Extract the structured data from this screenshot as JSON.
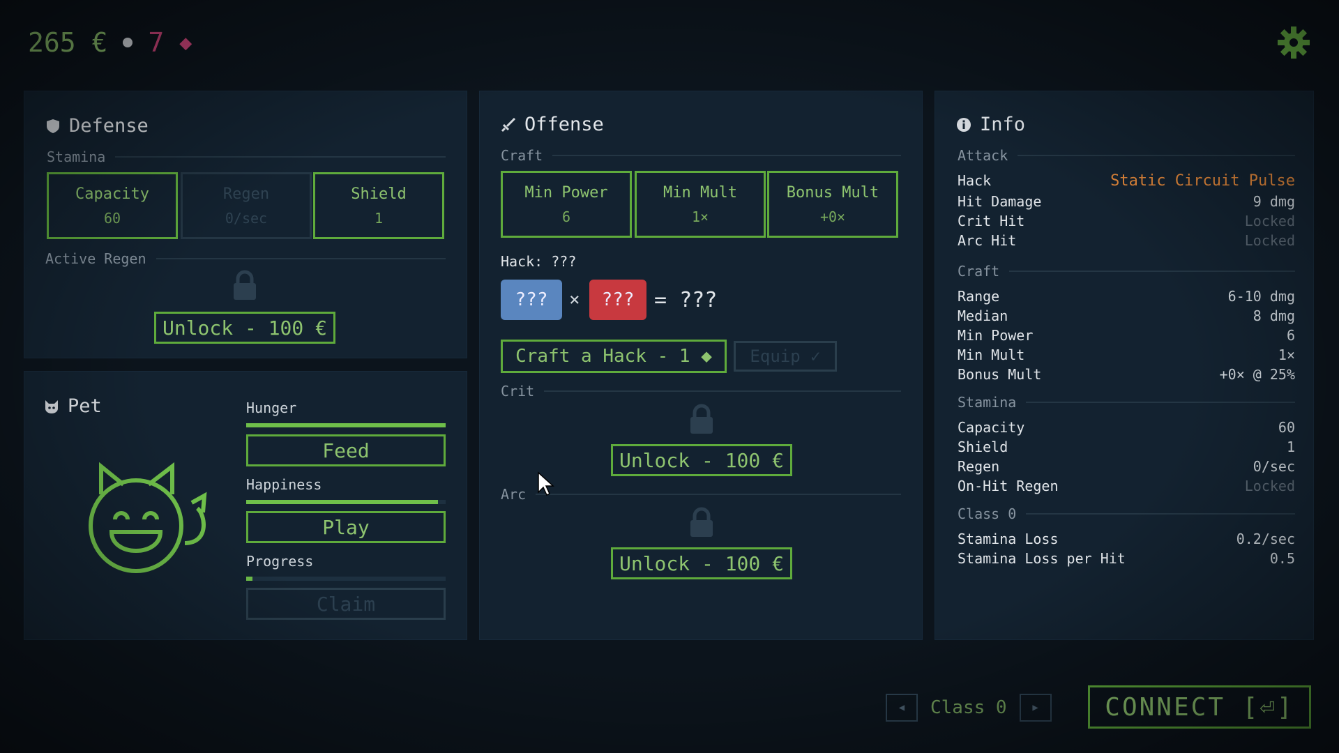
{
  "topbar": {
    "currency": "265 €",
    "gems": "7",
    "gem_icon": "◆"
  },
  "defense": {
    "title": "Defense",
    "stamina_label": "Stamina",
    "stats": [
      {
        "label": "Capacity",
        "value": "60"
      },
      {
        "label": "Regen",
        "value": "0/sec"
      },
      {
        "label": "Shield",
        "value": "1"
      }
    ],
    "active_regen_label": "Active Regen",
    "unlock_label": "Unlock - 100 €"
  },
  "pet": {
    "title": "Pet",
    "hunger_label": "Hunger",
    "hunger_level": 1.0,
    "feed_label": "Feed",
    "happiness_label": "Happiness",
    "happiness_level": 0.96,
    "play_label": "Play",
    "progress_label": "Progress",
    "progress_level": 0.03,
    "claim_label": "Claim"
  },
  "offense": {
    "title": "Offense",
    "craft_label": "Craft",
    "stats": [
      {
        "label": "Min Power",
        "value": "6"
      },
      {
        "label": "Min Mult",
        "value": "1×"
      },
      {
        "label": "Bonus Mult",
        "value": "+0×"
      }
    ],
    "hack_label": "Hack: ???",
    "formula": {
      "left": "???",
      "op": "×",
      "right": "???",
      "result": "= ???"
    },
    "craft_button": "Craft a Hack - 1 ◆",
    "equip_button": "Equip ✓",
    "crit_label": "Crit",
    "crit_unlock": "Unlock - 100 €",
    "arc_label": "Arc",
    "arc_unlock": "Unlock - 100 €"
  },
  "info": {
    "title": "Info",
    "attack_label": "Attack",
    "attack_rows": [
      {
        "k": "Hack",
        "v": "Static Circuit Pulse"
      },
      {
        "k": "Hit Damage",
        "v": "9 dmg"
      },
      {
        "k": "Crit Hit",
        "v": "Locked"
      },
      {
        "k": "Arc Hit",
        "v": "Locked"
      }
    ],
    "craft_label": "Craft",
    "craft_rows": [
      {
        "k": "Range",
        "v": "6-10 dmg"
      },
      {
        "k": "Median",
        "v": "8 dmg"
      },
      {
        "k": "Min Power",
        "v": "6"
      },
      {
        "k": "Min Mult",
        "v": "1×"
      },
      {
        "k": "Bonus Mult",
        "v": "+0× @ 25%"
      }
    ],
    "stamina_label": "Stamina",
    "stamina_rows": [
      {
        "k": "Capacity",
        "v": "60"
      },
      {
        "k": "Shield",
        "v": "1"
      },
      {
        "k": "Regen",
        "v": "0/sec"
      },
      {
        "k": "On-Hit Regen",
        "v": "Locked"
      }
    ],
    "class_label": "Class 0",
    "class_rows": [
      {
        "k": "Stamina Loss",
        "v": "0.2/sec"
      },
      {
        "k": "Stamina Loss per Hit",
        "v": "0.5"
      }
    ]
  },
  "bottom": {
    "prev_icon": "◀",
    "class_label": "Class 0",
    "next_icon": "▶",
    "connect_label": "CONNECT [⏎]"
  }
}
